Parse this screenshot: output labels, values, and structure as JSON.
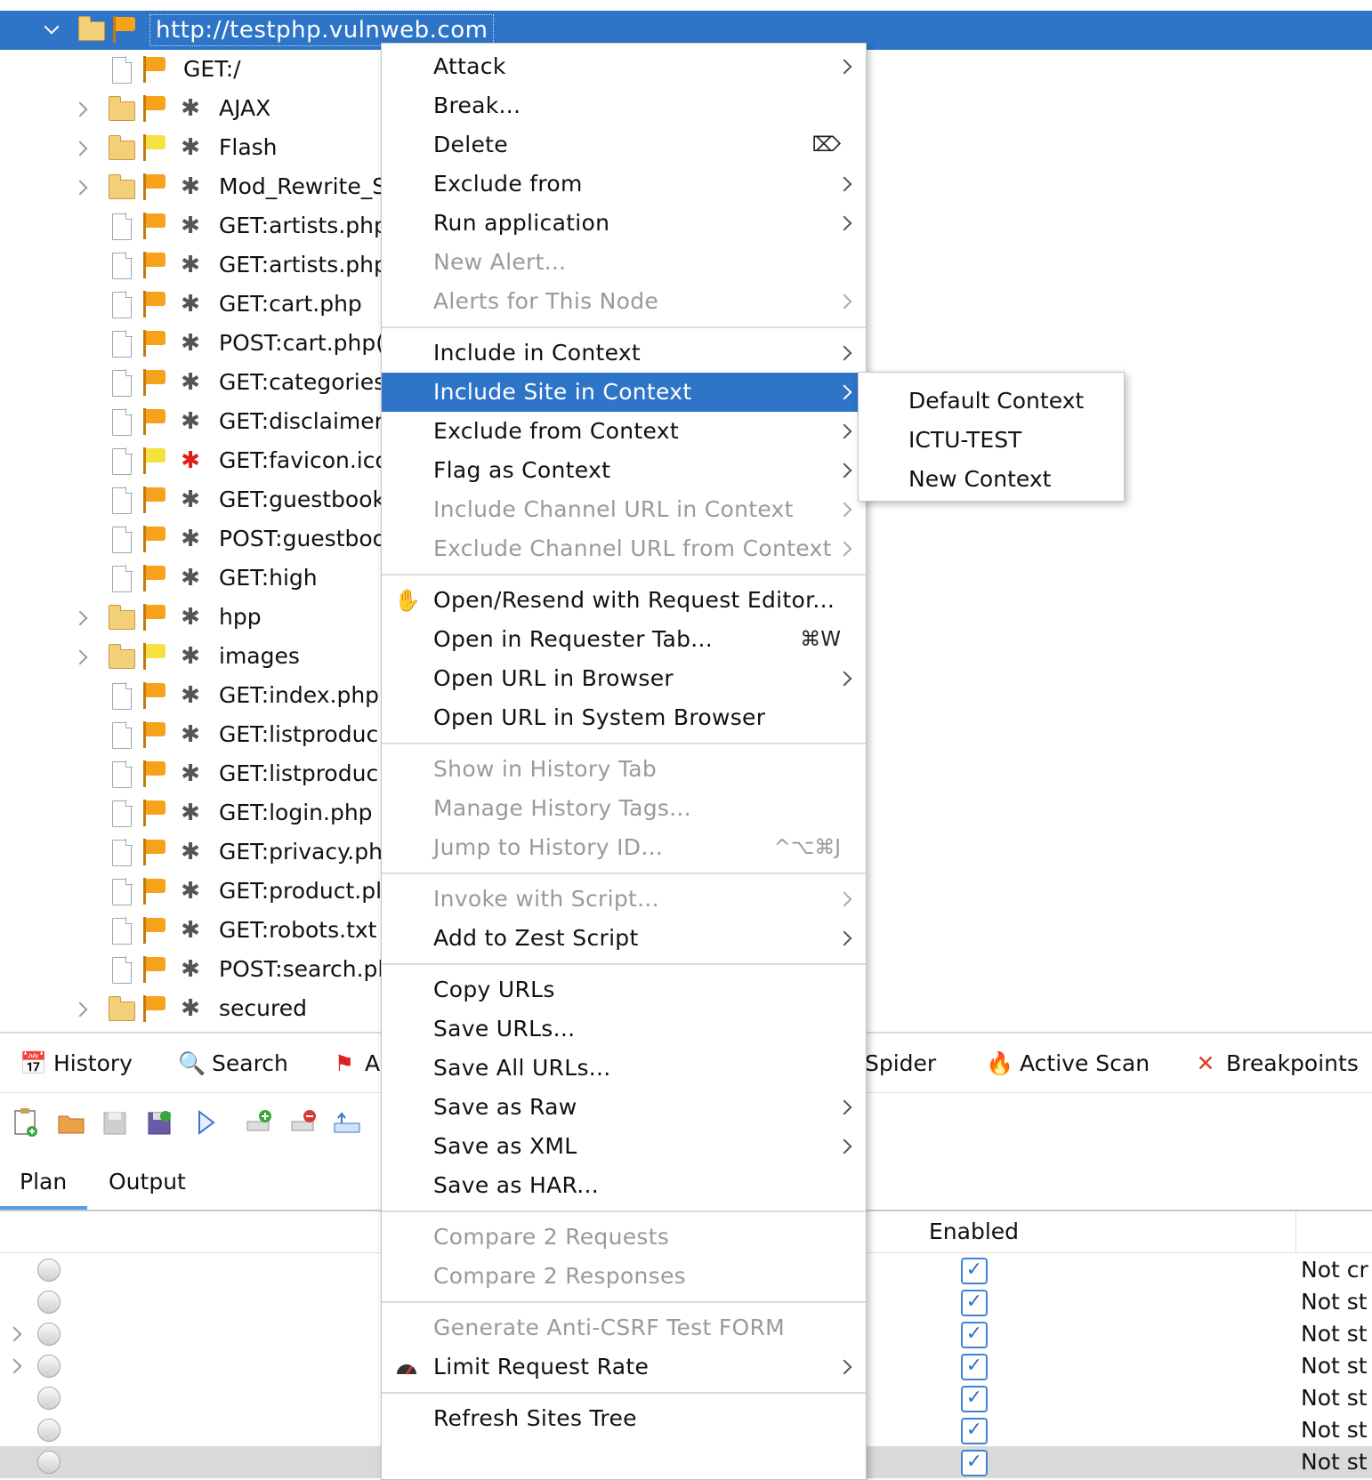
{
  "sites_tree": {
    "root_label": "http://testphp.vulnweb.com",
    "nodes": [
      {
        "label": "GET:/",
        "kind": "file",
        "flag": "orange",
        "spider": "none",
        "expandable": false
      },
      {
        "label": "AJAX",
        "kind": "folder",
        "flag": "orange",
        "spider": "gray",
        "expandable": true
      },
      {
        "label": "Flash",
        "kind": "folder",
        "flag": "yellow",
        "spider": "gray",
        "expandable": true
      },
      {
        "label": "Mod_Rewrite_S",
        "kind": "folder",
        "flag": "orange",
        "spider": "gray",
        "expandable": true
      },
      {
        "label": "GET:artists.php",
        "kind": "file",
        "flag": "orange",
        "spider": "gray",
        "expandable": false
      },
      {
        "label": "GET:artists.php",
        "kind": "file",
        "flag": "orange",
        "spider": "gray",
        "expandable": false
      },
      {
        "label": "GET:cart.php",
        "kind": "file",
        "flag": "orange",
        "spider": "gray",
        "expandable": false
      },
      {
        "label": "POST:cart.php(",
        "kind": "file",
        "flag": "orange",
        "spider": "gray",
        "expandable": false
      },
      {
        "label": "GET:categories",
        "kind": "file",
        "flag": "orange",
        "spider": "gray",
        "expandable": false
      },
      {
        "label": "GET:disclaimer",
        "kind": "file",
        "flag": "orange",
        "spider": "gray",
        "expandable": false
      },
      {
        "label": "GET:favicon.ico",
        "kind": "file",
        "flag": "yellow",
        "spider": "red",
        "expandable": false
      },
      {
        "label": "GET:guestbook",
        "kind": "file",
        "flag": "orange",
        "spider": "gray",
        "expandable": false
      },
      {
        "label": "POST:guestboo",
        "kind": "file",
        "flag": "orange",
        "spider": "gray",
        "expandable": false
      },
      {
        "label": "GET:high",
        "kind": "file",
        "flag": "orange",
        "spider": "gray",
        "expandable": false
      },
      {
        "label": "hpp",
        "kind": "folder",
        "flag": "orange",
        "spider": "gray",
        "expandable": true
      },
      {
        "label": "images",
        "kind": "folder",
        "flag": "yellow",
        "spider": "gray",
        "expandable": true
      },
      {
        "label": "GET:index.php",
        "kind": "file",
        "flag": "orange",
        "spider": "gray",
        "expandable": false
      },
      {
        "label": "GET:listproduc",
        "kind": "file",
        "flag": "orange",
        "spider": "gray",
        "expandable": false
      },
      {
        "label": "GET:listproduc",
        "kind": "file",
        "flag": "orange",
        "spider": "gray",
        "expandable": false
      },
      {
        "label": "GET:login.php",
        "kind": "file",
        "flag": "orange",
        "spider": "gray",
        "expandable": false
      },
      {
        "label": "GET:privacy.ph",
        "kind": "file",
        "flag": "orange",
        "spider": "gray",
        "expandable": false
      },
      {
        "label": "GET:product.pl",
        "kind": "file",
        "flag": "orange",
        "spider": "gray",
        "expandable": false
      },
      {
        "label": "GET:robots.txt",
        "kind": "file",
        "flag": "orange",
        "spider": "gray",
        "expandable": false
      },
      {
        "label": "POST:search.pl",
        "kind": "file",
        "flag": "orange",
        "spider": "gray",
        "expandable": false
      },
      {
        "label": "secured",
        "kind": "folder",
        "flag": "orange",
        "spider": "gray",
        "expandable": true
      }
    ]
  },
  "bottom_tabs": [
    {
      "label": "History",
      "icon": "calendar-icon"
    },
    {
      "label": "Search",
      "icon": "magnifier-icon"
    },
    {
      "label": "A",
      "icon": "flag-icon"
    },
    {
      "label": "Spider",
      "icon": "spider-icon"
    },
    {
      "label": "Active Scan",
      "icon": "flame-icon"
    },
    {
      "label": "Breakpoints",
      "icon": "x-icon"
    }
  ],
  "sub_tabs": {
    "plan": "Plan",
    "output": "Output"
  },
  "table": {
    "enabled_header": "Enabled",
    "rows": [
      {
        "status": "Not cr",
        "enabled": true,
        "expandable": false,
        "selected": false
      },
      {
        "status": "Not st",
        "enabled": true,
        "expandable": false,
        "selected": false
      },
      {
        "status": "Not st",
        "enabled": true,
        "expandable": true,
        "selected": false
      },
      {
        "status": "Not st",
        "enabled": true,
        "expandable": true,
        "selected": false
      },
      {
        "status": "Not st",
        "enabled": true,
        "expandable": false,
        "selected": false
      },
      {
        "status": "Not st",
        "enabled": true,
        "expandable": false,
        "selected": false
      },
      {
        "status": "Not st",
        "enabled": true,
        "expandable": false,
        "selected": true
      }
    ]
  },
  "context_menu": {
    "groups": [
      [
        {
          "label": "Attack",
          "submenu": true,
          "disabled": false
        },
        {
          "label": "Break...",
          "submenu": false,
          "disabled": false
        },
        {
          "label": "Delete",
          "submenu": false,
          "disabled": false,
          "shortcut": "⌦"
        },
        {
          "label": "Exclude from",
          "submenu": true,
          "disabled": false
        },
        {
          "label": "Run application",
          "submenu": true,
          "disabled": false
        },
        {
          "label": "New Alert...",
          "submenu": false,
          "disabled": true
        },
        {
          "label": "Alerts for This Node",
          "submenu": true,
          "disabled": true
        }
      ],
      [
        {
          "label": "Include in Context",
          "submenu": true,
          "disabled": false
        },
        {
          "label": "Include Site in Context",
          "submenu": true,
          "disabled": false,
          "highlighted": true
        },
        {
          "label": "Exclude from Context",
          "submenu": true,
          "disabled": false
        },
        {
          "label": "Flag as Context",
          "submenu": true,
          "disabled": false
        },
        {
          "label": "Include Channel URL in Context",
          "submenu": true,
          "disabled": true
        },
        {
          "label": "Exclude Channel URL from Context",
          "submenu": true,
          "disabled": true
        }
      ],
      [
        {
          "label": "Open/Resend with Request Editor...",
          "submenu": false,
          "disabled": false,
          "icon": "hand-icon"
        },
        {
          "label": "Open in Requester Tab...",
          "submenu": false,
          "disabled": false,
          "shortcut": "⌘W"
        },
        {
          "label": "Open URL in Browser",
          "submenu": true,
          "disabled": false
        },
        {
          "label": "Open URL in System Browser",
          "submenu": false,
          "disabled": false
        }
      ],
      [
        {
          "label": "Show in History Tab",
          "submenu": false,
          "disabled": true
        },
        {
          "label": "Manage History Tags...",
          "submenu": false,
          "disabled": true
        },
        {
          "label": "Jump to History ID...",
          "submenu": false,
          "disabled": true,
          "shortcut": "^⌥⌘J"
        }
      ],
      [
        {
          "label": "Invoke with Script...",
          "submenu": true,
          "disabled": true
        },
        {
          "label": "Add to Zest Script",
          "submenu": true,
          "disabled": false
        }
      ],
      [
        {
          "label": "Copy URLs",
          "submenu": false,
          "disabled": false
        },
        {
          "label": "Save URLs...",
          "submenu": false,
          "disabled": false
        },
        {
          "label": "Save All URLs...",
          "submenu": false,
          "disabled": false
        },
        {
          "label": "Save as Raw",
          "submenu": true,
          "disabled": false
        },
        {
          "label": "Save as XML",
          "submenu": true,
          "disabled": false
        },
        {
          "label": "Save as HAR...",
          "submenu": false,
          "disabled": false
        }
      ],
      [
        {
          "label": "Compare 2 Requests",
          "submenu": false,
          "disabled": true
        },
        {
          "label": "Compare 2 Responses",
          "submenu": false,
          "disabled": true
        }
      ],
      [
        {
          "label": "Generate Anti-CSRF Test FORM",
          "submenu": false,
          "disabled": true
        },
        {
          "label": "Limit Request Rate",
          "submenu": true,
          "disabled": false,
          "icon": "gauge-icon"
        }
      ],
      [
        {
          "label": "Refresh Sites Tree",
          "submenu": false,
          "disabled": false
        }
      ]
    ]
  },
  "context_submenu": {
    "items": [
      "Default Context",
      "ICTU-TEST",
      "New Context"
    ]
  }
}
